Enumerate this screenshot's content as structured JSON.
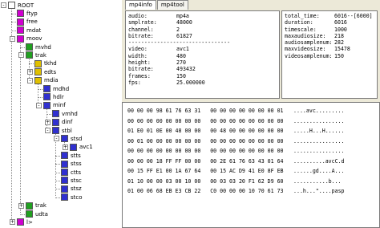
{
  "tree": [
    {
      "label": "ROOT",
      "color": "#ffffff",
      "depth": 0,
      "expander": "-"
    },
    {
      "label": "ftyp",
      "color": "#d000d0",
      "depth": 1,
      "expander": ""
    },
    {
      "label": "free",
      "color": "#d000d0",
      "depth": 1,
      "expander": ""
    },
    {
      "label": "mdat",
      "color": "#d000d0",
      "depth": 1,
      "expander": ""
    },
    {
      "label": "moov",
      "color": "#d000d0",
      "depth": 1,
      "expander": "-"
    },
    {
      "label": "mvhd",
      "color": "#20a020",
      "depth": 2,
      "expander": ""
    },
    {
      "label": "trak",
      "color": "#20a020",
      "depth": 2,
      "expander": "-"
    },
    {
      "label": "tkhd",
      "color": "#e0c000",
      "depth": 3,
      "expander": ""
    },
    {
      "label": "edts",
      "color": "#e0c000",
      "depth": 3,
      "expander": "+"
    },
    {
      "label": "mdia",
      "color": "#e0c000",
      "depth": 3,
      "expander": "-"
    },
    {
      "label": "mdhd",
      "color": "#3030d0",
      "depth": 4,
      "expander": ""
    },
    {
      "label": "hdlr",
      "color": "#3030d0",
      "depth": 4,
      "expander": ""
    },
    {
      "label": "minf",
      "color": "#3030d0",
      "depth": 4,
      "expander": "-"
    },
    {
      "label": "vmhd",
      "color": "#3030d0",
      "depth": 5,
      "expander": ""
    },
    {
      "label": "dinf",
      "color": "#3030d0",
      "depth": 5,
      "expander": "+"
    },
    {
      "label": "stbl",
      "color": "#3030d0",
      "depth": 5,
      "expander": "-"
    },
    {
      "label": "stsd",
      "color": "#3030d0",
      "depth": 6,
      "expander": "-"
    },
    {
      "label": "avc1",
      "color": "#3030d0",
      "depth": 7,
      "expander": "+"
    },
    {
      "label": "stts",
      "color": "#3030d0",
      "depth": 6,
      "expander": ""
    },
    {
      "label": "stss",
      "color": "#3030d0",
      "depth": 6,
      "expander": ""
    },
    {
      "label": "ctts",
      "color": "#3030d0",
      "depth": 6,
      "expander": ""
    },
    {
      "label": "stsc",
      "color": "#3030d0",
      "depth": 6,
      "expander": ""
    },
    {
      "label": "stsz",
      "color": "#3030d0",
      "depth": 6,
      "expander": ""
    },
    {
      "label": "stco",
      "color": "#3030d0",
      "depth": 6,
      "expander": ""
    },
    {
      "label": "trak",
      "color": "#20a020",
      "depth": 2,
      "expander": "+"
    },
    {
      "label": "udta",
      "color": "#20a020",
      "depth": 2,
      "expander": ""
    },
    {
      "label": "l>",
      "color": "#d000d0",
      "depth": 1,
      "expander": "+"
    }
  ],
  "tabs": [
    {
      "label": "mp4info"
    },
    {
      "label": "mp4tool"
    }
  ],
  "info_left": [
    {
      "k": "audio:",
      "v": "mp4a"
    },
    {
      "k": "smplrate:",
      "v": "48000"
    },
    {
      "k": "channel:",
      "v": "2"
    },
    {
      "k": "bitrate:",
      "v": "61827"
    },
    {
      "k": "---------------",
      "v": "-----------------"
    },
    {
      "k": "video:",
      "v": "avc1"
    },
    {
      "k": "width:",
      "v": "480"
    },
    {
      "k": "height:",
      "v": "270"
    },
    {
      "k": "bitrate:",
      "v": "493432"
    },
    {
      "k": "frames:",
      "v": "150"
    },
    {
      "k": "fps:",
      "v": "25.000000"
    }
  ],
  "info_right": [
    {
      "k": "total_time:",
      "v": "6016--[6000]"
    },
    {
      "k": "duration:",
      "v": "6016"
    },
    {
      "k": "timescale:",
      "v": "1000"
    },
    {
      "k": "maxaudiosize:",
      "v": "218"
    },
    {
      "k": "audiosamplenum:",
      "v": "282"
    },
    {
      "k": "maxvideosize:",
      "v": "15478"
    },
    {
      "k": "videosamplenum:",
      "v": "150"
    }
  ],
  "hex_rows": [
    {
      "hex": "00 00 00 98 61 76 63 31   00 00 00 00 00 00 00 01",
      "ascii": "....avc........."
    },
    {
      "hex": "00 00 00 00 00 00 00 00   00 00 00 00 00 00 00 00",
      "ascii": "................"
    },
    {
      "hex": "01 E0 01 0E 00 48 00 00   00 48 00 00 00 00 00 00",
      "ascii": ".....H...H......"
    },
    {
      "hex": "00 01 00 00 00 00 00 00   00 00 00 00 00 00 00 00",
      "ascii": "................"
    },
    {
      "hex": "00 00 00 00 00 00 00 00   00 00 00 00 00 00 00 00",
      "ascii": "................"
    },
    {
      "hex": "00 00 00 18 FF FF 00 00   00 2E 61 76 63 43 01 64",
      "ascii": "..........avcC.d"
    },
    {
      "hex": "00 15 FF E1 00 1A 67 64   00 15 AC D9 41 E0 8F EB",
      "ascii": "......gd....A..."
    },
    {
      "hex": "01 10 00 00 03 00 10 00   00 03 03 20 F1 62 D9 60",
      "ascii": "...........b..."
    },
    {
      "hex": "01 00 06 68 EB E3 CB 22   C0 00 00 00 10 70 61 73",
      "ascii": "...h...\"....pasp"
    }
  ]
}
